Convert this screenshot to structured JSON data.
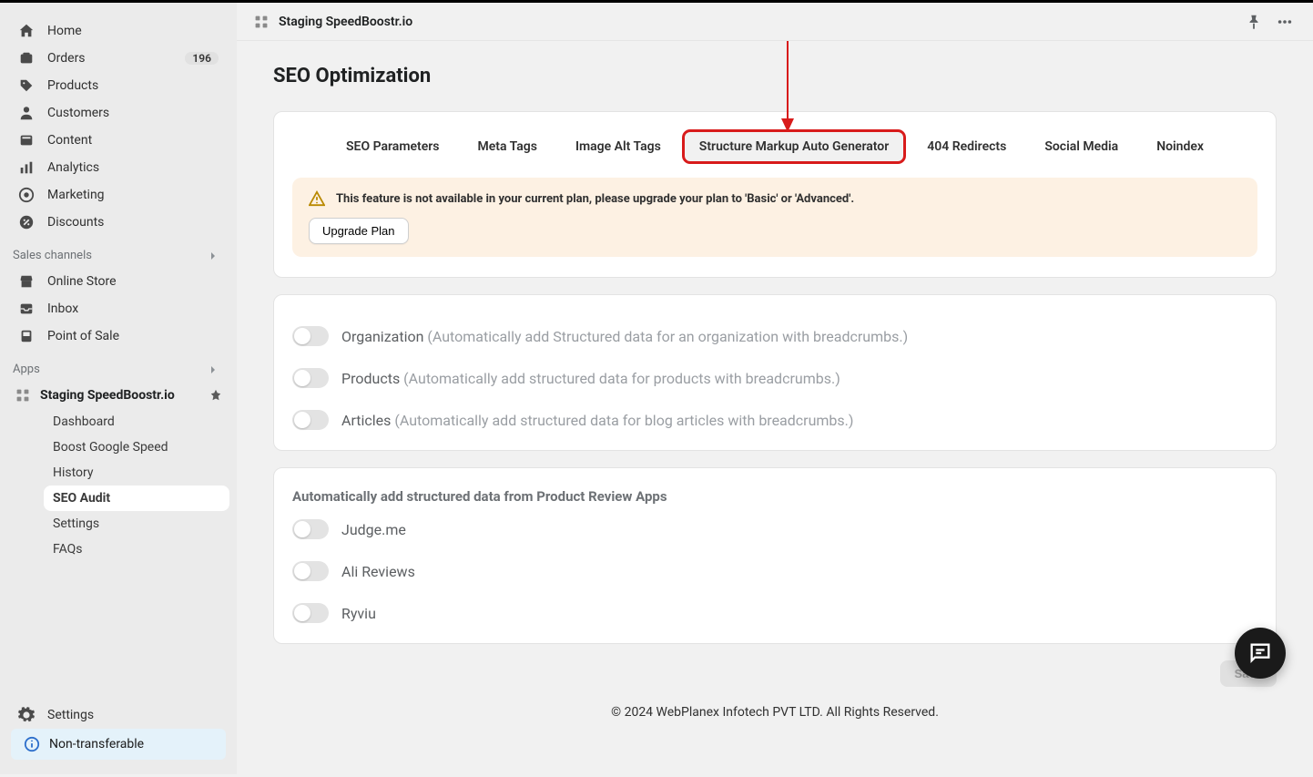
{
  "topbar": {
    "app_name": "Staging SpeedBoostr.io"
  },
  "sidebar": {
    "primary": [
      {
        "label": "Home",
        "icon": "home"
      },
      {
        "label": "Orders",
        "icon": "orders",
        "badge": "196"
      },
      {
        "label": "Products",
        "icon": "products"
      },
      {
        "label": "Customers",
        "icon": "customers"
      },
      {
        "label": "Content",
        "icon": "content"
      },
      {
        "label": "Analytics",
        "icon": "analytics"
      },
      {
        "label": "Marketing",
        "icon": "marketing"
      },
      {
        "label": "Discounts",
        "icon": "discounts"
      }
    ],
    "sales_channels_title": "Sales channels",
    "sales_channels": [
      {
        "label": "Online Store",
        "icon": "store"
      },
      {
        "label": "Inbox",
        "icon": "inbox"
      },
      {
        "label": "Point of Sale",
        "icon": "pos"
      }
    ],
    "apps_title": "Apps",
    "app": {
      "name": "Staging SpeedBoostr.io",
      "items": [
        {
          "label": "Dashboard"
        },
        {
          "label": "Boost Google Speed"
        },
        {
          "label": "History"
        },
        {
          "label": "SEO Audit",
          "selected": true
        },
        {
          "label": "Settings"
        },
        {
          "label": "FAQs"
        }
      ]
    },
    "settings_label": "Settings",
    "non_transferable": "Non-transferable"
  },
  "page": {
    "title": "SEO Optimization",
    "tabs": [
      {
        "label": "SEO Parameters"
      },
      {
        "label": "Meta Tags"
      },
      {
        "label": "Image Alt Tags"
      },
      {
        "label": "Structure Markup Auto Generator",
        "active": true,
        "highlight": true
      },
      {
        "label": "404 Redirects"
      },
      {
        "label": "Social Media"
      },
      {
        "label": "Noindex"
      }
    ],
    "warning": {
      "text": "This feature is not available in your current plan, please upgrade your plan to 'Basic' or 'Advanced'.",
      "button": "Upgrade Plan"
    },
    "toggles_main": [
      {
        "title": "Organization",
        "desc": "(Automatically add Structured data for an organization with breadcrumbs.)"
      },
      {
        "title": "Products",
        "desc": "(Automatically add structured data for products with breadcrumbs.)"
      },
      {
        "title": "Articles",
        "desc": "(Automatically add structured data for blog articles with breadcrumbs.)"
      }
    ],
    "review_section_title": "Automatically add structured data from Product Review Apps",
    "review_toggles": [
      {
        "title": "Judge.me"
      },
      {
        "title": "Ali Reviews"
      },
      {
        "title": "Ryviu"
      }
    ],
    "save_label": "Save",
    "footer": "© 2024 WebPlanex Infotech PVT LTD. All Rights Reserved."
  }
}
